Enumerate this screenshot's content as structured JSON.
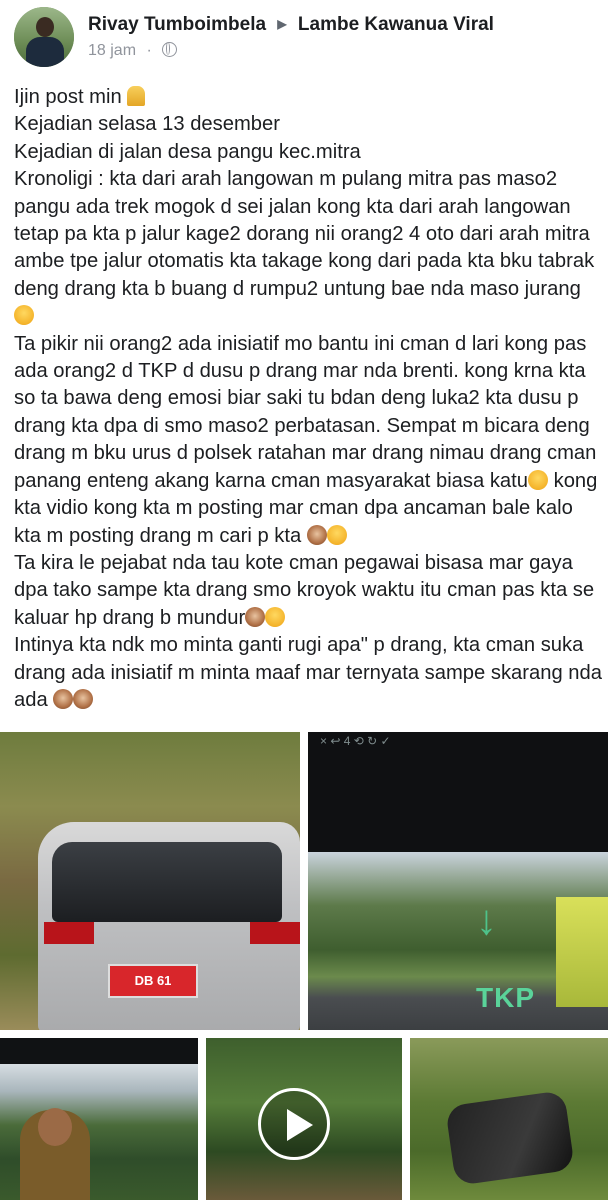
{
  "post": {
    "author": "Rivay Tumboimbela",
    "group": "Lambe Kawanua Viral",
    "time": "18 jam",
    "dot": "·",
    "lines": [
      "Ijin post min",
      "Kejadian selasa 13 desember",
      "Kejadian di jalan desa pangu kec.mitra",
      "Kronoligi : kta dari arah langowan m pulang mitra pas maso2 pangu ada trek mogok d sei jalan kong kta dari arah langowan tetap pa kta p jalur kage2 dorang nii orang2 4 oto dari arah mitra ambe tpe jalur otomatis kta takage kong dari pada kta bku tabrak deng drang kta b buang d rumpu2 untung bae nda maso jurang",
      "Ta pikir nii orang2 ada inisiatif mo bantu ini cman d lari kong pas ada orang2 d TKP d dusu p drang mar nda brenti. kong krna kta so ta bawa deng emosi biar saki tu bdan deng luka2 kta dusu p drang kta dpa di smo maso2 perbatasan. Sempat m bicara deng drang m bku urus d polsek ratahan mar drang nimau drang cman panang enteng akang karna cman masyarakat biasa katu",
      "kong kta vidio kong kta m posting mar cman dpa ancaman bale kalo kta m posting drang m cari p kta",
      "Ta kira le pejabat nda tau kote cman pegawai bisasa mar gaya dpa tako sampe kta drang smo kroyok waktu itu cman pas kta se kaluar hp drang b mundur",
      "Intinya kta ndk mo minta ganti rugi apa\" p drang, kta cman suka drang ada inisiatif m minta maaf mar ternyata sampe skarang nda ada"
    ]
  },
  "photos": {
    "plate_text": "DB 61",
    "tkp_label": "TKP",
    "topbar_symbols": "×   ↩   4   ⟲   ↻   ✓"
  },
  "icons": {
    "avatar": "avatar",
    "globe": "globe-icon",
    "arrow": "triangle-right-icon",
    "play": "play-icon"
  }
}
